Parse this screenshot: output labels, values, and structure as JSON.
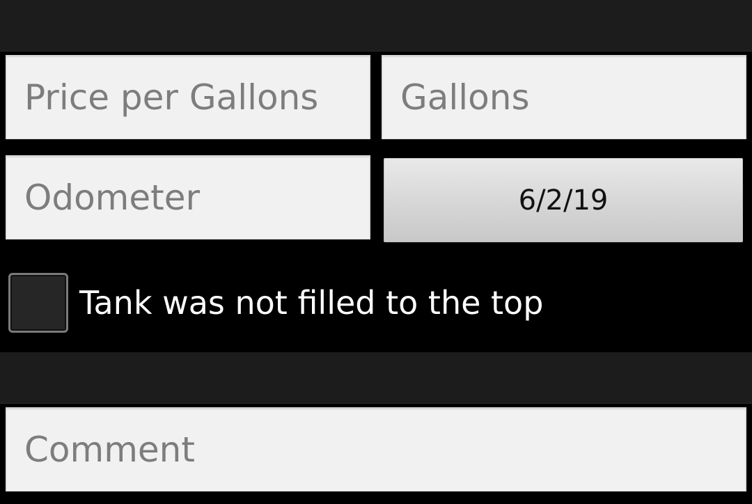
{
  "form": {
    "price_per_gallon": {
      "placeholder": "Price per Gallons",
      "value": ""
    },
    "gallons": {
      "placeholder": "Gallons",
      "value": ""
    },
    "odometer": {
      "placeholder": "Odometer",
      "value": ""
    },
    "date_button_label": "6/2/19",
    "partial_fill": {
      "label": "Tank was not filled to the top",
      "checked": false
    },
    "comment": {
      "placeholder": "Comment",
      "value": ""
    }
  }
}
